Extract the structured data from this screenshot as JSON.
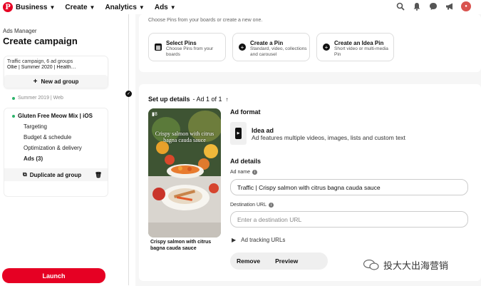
{
  "topbar": {
    "logo": "P",
    "nav": [
      {
        "label": "Business",
        "icon": "chevron-down-icon"
      },
      {
        "label": "Create",
        "icon": "chevron-down-icon"
      },
      {
        "label": "Analytics",
        "icon": "chevron-down-icon"
      },
      {
        "label": "Ads",
        "icon": "chevron-down-icon"
      }
    ],
    "icons": [
      "search-icon",
      "bell-icon",
      "chat-icon",
      "megaphone-icon"
    ],
    "accent": "#e60023"
  },
  "sidebar": {
    "subtitle": "Ads Manager",
    "title": "Create campaign",
    "campaign": {
      "line1": "Traffic campaign, 6 ad groups",
      "line2": "Ollie | Summer 2020 | Health…",
      "new_ad_group": "New ad group"
    },
    "ad_group_other": "Summer 2019 | Web",
    "ad_group": {
      "title": "Gluten Free Meow Mix | iOS",
      "items": [
        "Targeting",
        "Budget & schedule",
        "Optimization & delivery",
        "Ads (3)"
      ],
      "duplicate": "Duplicate ad group"
    },
    "launch": "Launch"
  },
  "create_options": {
    "hint": "Choose Pins from your boards or create a new one.",
    "options": [
      {
        "title": "Select Pins",
        "desc": "Choose Pins from your boards",
        "icon": "grid-icon"
      },
      {
        "title": "Create a Pin",
        "desc": "Standard, video, collections and carousel",
        "icon": "plus-icon"
      },
      {
        "title": "Create an Idea Pin",
        "desc": "Short video or multi-media Pin",
        "icon": "plus-icon"
      }
    ]
  },
  "setup": {
    "title": "Set up details",
    "sub": "- Ad 1 of 1",
    "pin_overlay": "Crispy salmon with citrus bagna cauda sauce",
    "pin_caption": "Crispy salmon with citrus bagna cauda sauce",
    "pin_badge": "8",
    "ad_format_label": "Ad format",
    "format_title": "Idea ad",
    "format_desc": "Ad features multiple videos, images, lists and custom text",
    "ad_details_label": "Ad details",
    "ad_name_label": "Ad name",
    "ad_name_value": "Traffic | Crispy salmon with citrus bagna cauda sauce",
    "dest_label": "Destination URL",
    "dest_placeholder": "Enter a destination URL",
    "tracking": "Ad tracking URLs",
    "remove": "Remove",
    "preview": "Preview"
  },
  "watermark": "投大大出海营销"
}
